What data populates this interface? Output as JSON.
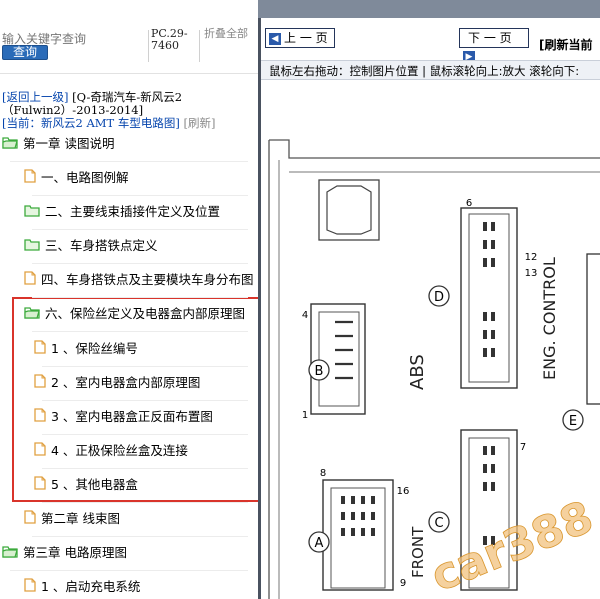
{
  "search": {
    "placeholder": "输入关键字查询",
    "button": "查询",
    "pc_code": "PC.29-7460",
    "collapse": "折叠全部"
  },
  "breadcrumb": {
    "back": "[返回上一级]",
    "model": "[Q-奇瑞汽车-新风云2（Fulwin2）-2013-2014]",
    "current_prefix": "[当前：",
    "current": "新风云2 AMT 车型电路图]",
    "refresh": "[刷新]"
  },
  "tree": [
    {
      "label": "第一章 读图说明",
      "icon": "folder-open-icon"
    },
    {
      "label": "一、电路图例解",
      "icon": "document-icon"
    },
    {
      "label": "二、主要线束插接件定义及位置",
      "icon": "folder-icon"
    },
    {
      "label": "三、车身搭铁点定义",
      "icon": "folder-icon"
    },
    {
      "label": "四、车身搭铁点及主要模块车身分布图",
      "icon": "document-icon"
    },
    {
      "label": "六、保险丝定义及电器盒内部原理图",
      "icon": "folder-open-icon"
    },
    {
      "label": "1 、保险丝编号",
      "icon": "document-icon"
    },
    {
      "label": "2 、室内电器盒内部原理图",
      "icon": "document-icon"
    },
    {
      "label": "3 、室内电器盒正反面布置图",
      "icon": "document-icon"
    },
    {
      "label": "4 、正极保险丝盒及连接",
      "icon": "document-icon"
    },
    {
      "label": "5 、其他电器盒",
      "icon": "document-icon"
    },
    {
      "label": "第二章 线束图",
      "icon": "document-icon"
    },
    {
      "label": "第三章 电路原理图",
      "icon": "folder-open-icon"
    },
    {
      "label": "1 、启动充电系统",
      "icon": "document-icon"
    }
  ],
  "viewer": {
    "prev_button": "上 一 页",
    "next_button": "下 一 页",
    "refresh_label": "[刷新当前",
    "hint": "鼠标左右拖动：控制图片位置 | 鼠标滚轮向上:放大   滚轮向下:"
  },
  "diagram_labels": {
    "abs": "ABS",
    "eng_control": "ENG. CONTROL",
    "front": "FRONT",
    "conn_b": "B",
    "conn_d": "D",
    "conn_e": "E",
    "conn_a": "A",
    "conn_c": "C",
    "pin_4": "4",
    "pin_1": "1",
    "pin_6": "6",
    "pin_12": "12",
    "pin_13": "13",
    "pin_7": "7",
    "pin_8": "8",
    "pin_16": "16",
    "pin_9": "9",
    "watermark": "car388"
  },
  "colors": {
    "folder": "#3caa3c",
    "document": "#e0a040",
    "highlight_box": "#d9342b",
    "button_blue": "#2a6bb8",
    "link_blue": "#0645ad"
  }
}
